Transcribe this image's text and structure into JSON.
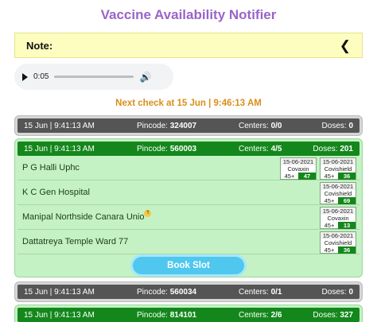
{
  "app": {
    "title": "Vaccine Availability Notifier"
  },
  "note": {
    "label": "Note:",
    "toggle_icon": "chevron-left-icon"
  },
  "audio": {
    "time": "0:05",
    "play_icon": "play-icon",
    "volume_icon": "volume-icon"
  },
  "next_check": "Next check at 15 Jun | 9:46:13 AM",
  "book_label": "Book Slot",
  "results": [
    {
      "status": "none",
      "timestamp": "15 Jun | 9:41:13 AM",
      "pincode_label": "Pincode:",
      "pincode": "324007",
      "centers_label": "Centers:",
      "centers": "0/0",
      "doses_label": "Doses:",
      "doses": "0"
    },
    {
      "status": "available",
      "timestamp": "15 Jun | 9:41:13 AM",
      "pincode_label": "Pincode:",
      "pincode": "560003",
      "centers_label": "Centers:",
      "centers": "4/5",
      "doses_label": "Doses:",
      "doses": "201",
      "centers_list": [
        {
          "name": "P G Halli Uphc",
          "slots": [
            {
              "date": "15-06-2021",
              "vaccine": "Covaxin",
              "age": "45+",
              "count": "47"
            },
            {
              "date": "15-06-2021",
              "vaccine": "Covishield",
              "age": "45+",
              "count": "36"
            }
          ]
        },
        {
          "name": "K C Gen Hospital",
          "slots": [
            {
              "date": "15-06-2021",
              "vaccine": "Covishield",
              "age": "45+",
              "count": "69"
            }
          ]
        },
        {
          "name": "Manipal Northside Canara Unio",
          "badge": "₹",
          "slots": [
            {
              "date": "15-06-2021",
              "vaccine": "Covaxin",
              "age": "45+",
              "count": "13"
            }
          ]
        },
        {
          "name": "Dattatreya Temple Ward 77",
          "slots": [
            {
              "date": "15-06-2021",
              "vaccine": "Covishield",
              "age": "45+",
              "count": "36"
            }
          ]
        }
      ]
    },
    {
      "status": "none",
      "timestamp": "15 Jun | 9:41:13 AM",
      "pincode_label": "Pincode:",
      "pincode": "560034",
      "centers_label": "Centers:",
      "centers": "0/1",
      "doses_label": "Doses:",
      "doses": "0"
    },
    {
      "status": "available",
      "timestamp": "15 Jun | 9:41:13 AM",
      "pincode_label": "Pincode:",
      "pincode": "814101",
      "centers_label": "Centers:",
      "centers": "2/6",
      "doses_label": "Doses:",
      "doses": "327"
    }
  ]
}
